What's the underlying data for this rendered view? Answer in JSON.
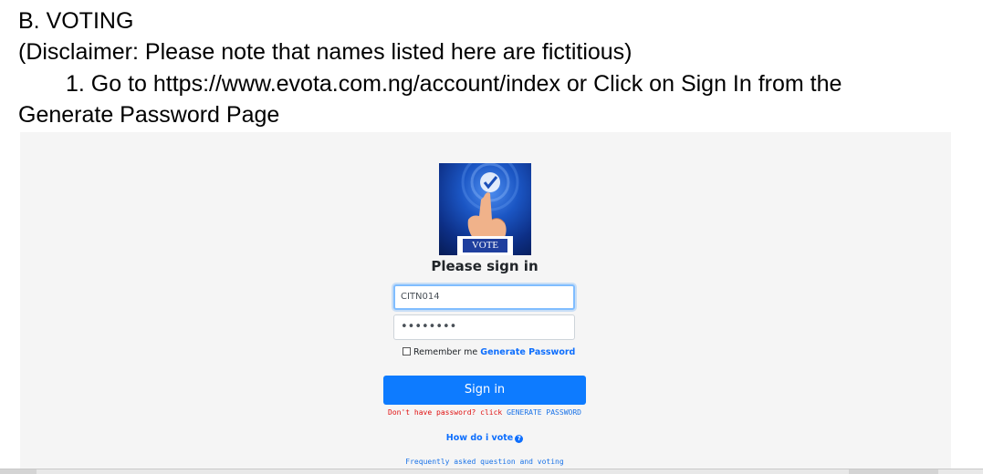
{
  "doc": {
    "heading": "B. VOTING",
    "disclaimer": "(Disclaimer: Please note that names listed here are fictitious)",
    "step1": "1. Go to https://www.evota.com.ng/account/index  or Click on Sign In from the",
    "step1_cont": "Generate Password Page"
  },
  "login": {
    "logo_text": "VOTE",
    "title": "Please sign in",
    "username_value": "CITN014",
    "password_value": "••••••••",
    "remember_label": "Remember me",
    "generate_link": "Generate Password",
    "signin_button": "Sign in",
    "no_password_text": "Don't have password? click",
    "generate_link_caps": "GENERATE PASSWORD",
    "how_vote": "How do i vote",
    "faq": "Frequently asked question and voting"
  },
  "colors": {
    "accent": "#0d7bff",
    "warning_text": "#e01010",
    "background": "#f5f5f5"
  }
}
